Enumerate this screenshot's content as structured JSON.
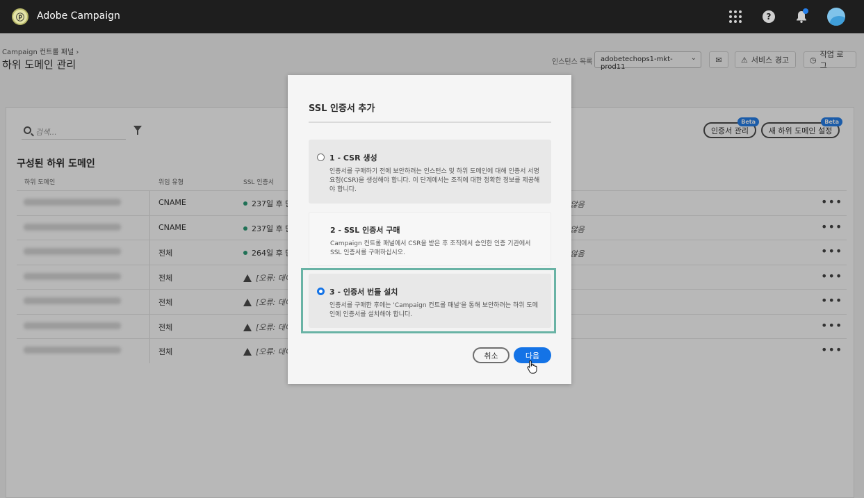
{
  "app": {
    "title": "Adobe Campaign"
  },
  "header": {
    "breadcrumb": "Campaign 컨트롤 패널",
    "breadcrumb_sep": "›",
    "page_title": "하위 도메인 관리",
    "instance_label": "인스턴스 목록",
    "instance_value": "adobetechops1-mkt-prod11",
    "service_alert": "서비스 경고",
    "job_log": "작업 로그"
  },
  "toolbar": {
    "search_placeholder": "검색...",
    "cert_manage": "인증서 관리",
    "new_subdomain": "새 하위 도메인 설정",
    "beta": "Beta"
  },
  "table": {
    "section_title": "구성된 하위 도메인",
    "columns": [
      "하위 도메인",
      "위임 유형",
      "SSL 인증서"
    ],
    "rows": [
      {
        "type": "CNAME",
        "ssl": "237일 후 만",
        "status": "ok",
        "extra": "l 않음"
      },
      {
        "type": "CNAME",
        "ssl": "237일 후 만",
        "status": "ok",
        "extra": "l 않음"
      },
      {
        "type": "전체",
        "ssl": "264일 후 만",
        "status": "ok",
        "extra": "l 않음"
      },
      {
        "type": "전체",
        "ssl": "[오류: 데이",
        "status": "error",
        "extra": ""
      },
      {
        "type": "전체",
        "ssl": "[오류: 데이",
        "status": "error",
        "extra": ""
      },
      {
        "type": "전체",
        "ssl": "[오류: 데이",
        "status": "error",
        "extra": ""
      },
      {
        "type": "전체",
        "ssl": "[오류: 데이",
        "status": "error",
        "extra": ""
      }
    ],
    "more": "•••"
  },
  "dialog": {
    "title": "SSL 인증서 추가",
    "steps": [
      {
        "label": "1 - CSR 생성",
        "desc": "인증서를 구매하기 전에 보안하려는 인스턴스 및 하위 도메인에 대해 인증서 서명 요청(CSR)을 생성해야 합니다. 이 단계에서는 조직에 대한 정확한 정보를 제공해야 합니다.",
        "selected": false
      },
      {
        "label": "2 - SSL 인증서 구매",
        "desc": "Campaign 컨트롤 패널에서 CSR을 받은 후 조직에서 승인한 인증 기관에서 SSL 인증서를 구매하십시오.",
        "selected": false
      },
      {
        "label": "3 - 인증서 번들 설치",
        "desc": "인증서를 구매한 후에는 'Campaign 컨트롤 패널'을 통해 보안하려는 하위 도메인에 인증서를 설치해야 합니다.",
        "selected": true
      }
    ],
    "cancel": "취소",
    "next": "다음"
  },
  "colors": {
    "accent": "#1473e6",
    "highlight": "#69b3a5",
    "topbar": "#1e1e1e"
  }
}
